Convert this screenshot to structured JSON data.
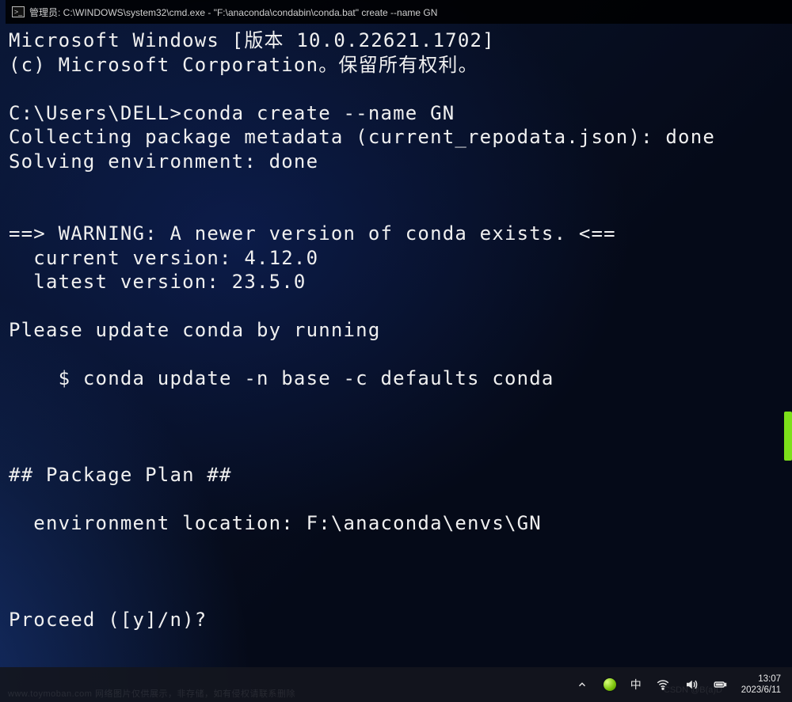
{
  "window": {
    "title": "管理员: C:\\WINDOWS\\system32\\cmd.exe - \"F:\\anaconda\\condabin\\conda.bat\"  create --name GN"
  },
  "terminal": {
    "lines": [
      "Microsoft Windows [版本 10.0.22621.1702]",
      "(c) Microsoft Corporation。保留所有权利。",
      "",
      "C:\\Users\\DELL>conda create --name GN",
      "Collecting package metadata (current_repodata.json): done",
      "Solving environment: done",
      "",
      "",
      "==> WARNING: A newer version of conda exists. <==",
      "  current version: 4.12.0",
      "  latest version: 23.5.0",
      "",
      "Please update conda by running",
      "",
      "    $ conda update -n base -c defaults conda",
      "",
      "",
      "",
      "## Package Plan ##",
      "",
      "  environment location: F:\\anaconda\\envs\\GN",
      "",
      "",
      "",
      "Proceed ([y]/n)?"
    ]
  },
  "taskbar": {
    "ime": "中",
    "time": "13:07",
    "date": "2023/6/11"
  },
  "watermarks": {
    "left": "www.toymoban.com 网络图片仅供展示，非存储，如有侵权请联系删除",
    "right": "CSDN @B(a)D"
  }
}
